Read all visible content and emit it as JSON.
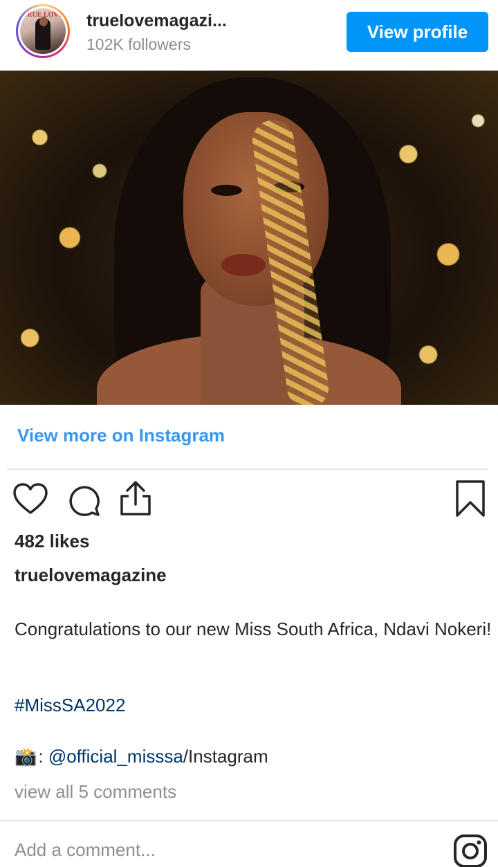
{
  "header": {
    "username": "truelovemagazi...",
    "followers": "102K followers",
    "view_profile_label": "View profile",
    "avatar_cover_text": "TRUE LOVE"
  },
  "post": {
    "view_more_label": "View more on Instagram",
    "likes": "482 likes",
    "author": "truelovemagazine",
    "caption": "Congratulations to our new Miss South Africa, Ndavi Nokeri!",
    "hashtag": "#MissSA2022",
    "credit_camera": "📸",
    "credit_sep": ": ",
    "credit_mention": "@official_misssa",
    "credit_suffix": "/Instagram",
    "view_comments": "view all 5 comments",
    "comment_placeholder": "Add a comment..."
  },
  "icons": [
    "heart-icon",
    "comment-icon",
    "share-icon",
    "bookmark-icon",
    "instagram-icon"
  ],
  "colors": {
    "accent_blue": "#0095f6",
    "link_blue": "#3897f0",
    "hashtag_blue": "#003569",
    "text": "#262626",
    "muted": "#8e8e8e"
  }
}
